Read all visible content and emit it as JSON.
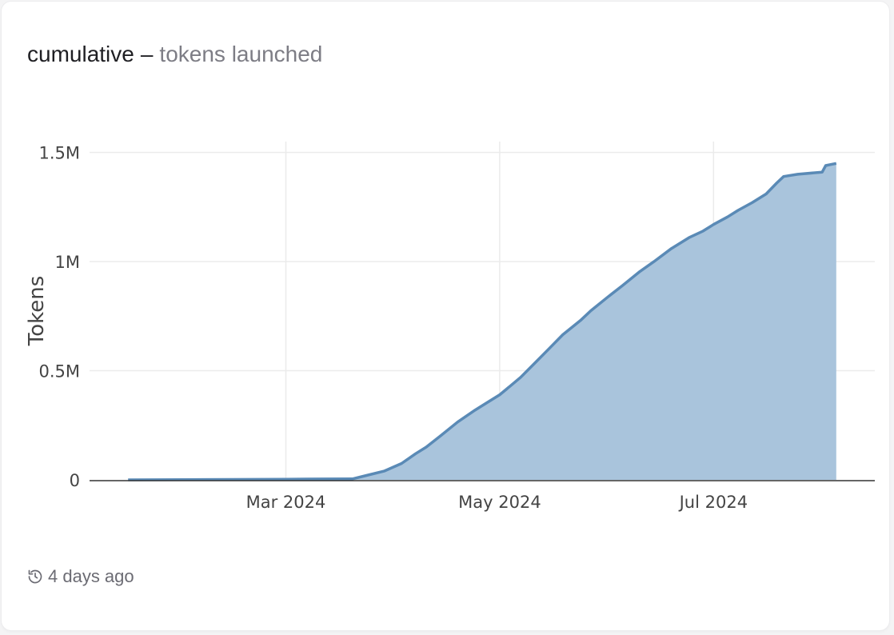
{
  "header": {
    "title": "cumulative",
    "separator": "–",
    "subtitle": "tokens launched"
  },
  "footer": {
    "icon": "history-icon",
    "timestamp": "4 days ago"
  },
  "colors": {
    "line": "#5a8ab6",
    "fill": "#a9c4dc",
    "grid": "#ebebeb",
    "axis": "#333333"
  },
  "chart_data": {
    "type": "area",
    "title": "",
    "xlabel": "",
    "ylabel": "Tokens",
    "grid": true,
    "legend": "none",
    "xlim": [
      "2024-01-05",
      "2024-08-16"
    ],
    "ylim": [
      0,
      1550000
    ],
    "x_ticks": [
      {
        "date": "2024-03-01",
        "label": "Mar 2024"
      },
      {
        "date": "2024-05-01",
        "label": "May 2024"
      },
      {
        "date": "2024-07-01",
        "label": "Jul 2024"
      }
    ],
    "y_ticks": [
      {
        "value": 0,
        "label": "0"
      },
      {
        "value": 500000,
        "label": "0.5M"
      },
      {
        "value": 1000000,
        "label": "1M"
      },
      {
        "value": 1500000,
        "label": "1.5M"
      }
    ],
    "series": [
      {
        "x": [
          "2024-01-16",
          "2024-02-01",
          "2024-02-15",
          "2024-03-01",
          "2024-03-12",
          "2024-03-20",
          "2024-03-24",
          "2024-03-29",
          "2024-04-03",
          "2024-04-07",
          "2024-04-10",
          "2024-04-14",
          "2024-04-19",
          "2024-04-24",
          "2024-04-28",
          "2024-05-01",
          "2024-05-04",
          "2024-05-07",
          "2024-05-11",
          "2024-05-15",
          "2024-05-19",
          "2024-05-24",
          "2024-05-27",
          "2024-06-01",
          "2024-06-05",
          "2024-06-10",
          "2024-06-14",
          "2024-06-19",
          "2024-06-24",
          "2024-06-28",
          "2024-07-01",
          "2024-07-05",
          "2024-07-08",
          "2024-07-12",
          "2024-07-16",
          "2024-07-19",
          "2024-07-21",
          "2024-07-25",
          "2024-08-01",
          "2024-08-02",
          "2024-08-05"
        ],
        "y": [
          0,
          1000,
          2000,
          3000,
          4000,
          4500,
          20000,
          40000,
          75000,
          120000,
          150000,
          200000,
          265000,
          320000,
          360000,
          390000,
          430000,
          470000,
          535000,
          600000,
          665000,
          730000,
          775000,
          840000,
          890000,
          955000,
          1000000,
          1060000,
          1110000,
          1140000,
          1170000,
          1205000,
          1235000,
          1270000,
          1310000,
          1360000,
          1390000,
          1400000,
          1410000,
          1440000,
          1450000
        ]
      }
    ]
  }
}
